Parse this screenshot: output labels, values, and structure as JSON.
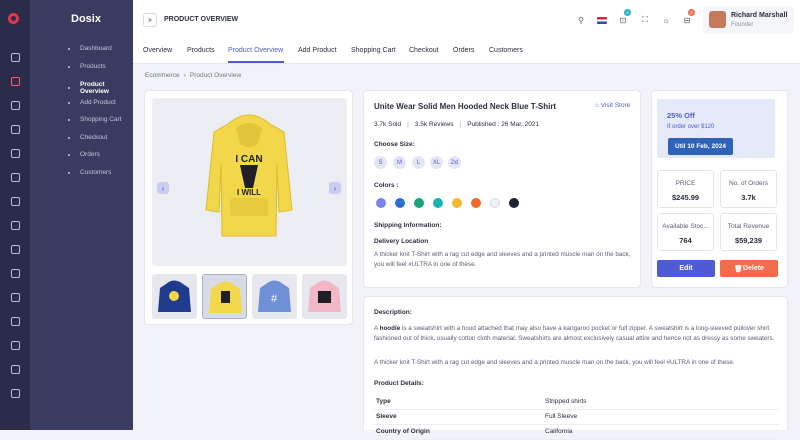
{
  "brand": {
    "name": "Dosix",
    "accent": "#e4354a",
    "sidebar_color": "#3a3b60"
  },
  "rail_icons": [
    "layout-icon",
    "cart-icon",
    "calendar-icon",
    "cards-icon",
    "mail-icon",
    "user-circle-icon",
    "id-card-icon",
    "box-icon",
    "layers-icon",
    "pen-icon",
    "table-icon",
    "grid-icon",
    "clock-icon",
    "flask-icon",
    "map-icon"
  ],
  "menu": {
    "items": [
      {
        "label": "Dashboard"
      },
      {
        "label": "Products"
      },
      {
        "label": "Product Overview"
      },
      {
        "label": "Add Product"
      },
      {
        "label": "Shopping Cart"
      },
      {
        "label": "Checkout"
      },
      {
        "label": "Orders"
      },
      {
        "label": "Customers"
      }
    ],
    "active": "Product Overview"
  },
  "header": {
    "expand_symbol": "»",
    "title": "PRODUCT OVERVIEW",
    "cart_badge": "4",
    "notif_badge": "3"
  },
  "user": {
    "name": "Richard Marshall",
    "role": "Founder"
  },
  "tabs": [
    "Overview",
    "Products",
    "Product Overview",
    "Add Product",
    "Shopping Cart",
    "Checkout",
    "Orders",
    "Customers"
  ],
  "active_tab": "Product Overview",
  "breadcrumb": {
    "parent": "Ecommerce",
    "sep": "›",
    "current": "Product Overview"
  },
  "product": {
    "name": "Unite Wear Solid Men Hooded Neck Blue T-Shirt",
    "visit_store": "Visit Store",
    "sold": "3.7k",
    "sold_label": "Sold",
    "reviews": "3.5k",
    "reviews_label": "Reviews",
    "published_label": "Published :",
    "published": "26 Mar, 2021",
    "size_title": "Choose Size:",
    "sizes": [
      "S",
      "M",
      "L",
      "XL",
      "2xl"
    ],
    "colors_title": "Colors :",
    "colors": [
      "#7c83e9",
      "#2e6dd0",
      "#1aa37a",
      "#19b3b3",
      "#f5b82e",
      "#ef6a2b",
      "#f1f2f5",
      "#1f2330"
    ],
    "shipping_title": "Shipping Information:",
    "delivery_title": "Delivery Location",
    "delivery_text": "A thicker knit T-Shirt with a rag cut edge and sleeves and a printed muscle man on the back, you will feel #ULTRA in one of these."
  },
  "offer": {
    "title": "25% Off",
    "subtitle": "If order over $120",
    "button": "Util 10 Feb, 2024"
  },
  "stats": [
    {
      "label": "PRICE",
      "value": "$245.99"
    },
    {
      "label": "No. of Orders",
      "value": "3.7k"
    },
    {
      "label": "Available Stoc...",
      "value": "764"
    },
    {
      "label": "Total Revenue",
      "value": "$59,239"
    }
  ],
  "actions": {
    "edit": "Edit",
    "delete": "Delete"
  },
  "description": {
    "title": "Description:",
    "p1_prefix": "A",
    "p1_bold": "hoodie",
    "p1_rest": "is a sweatshirt with a hood attached that may also have a kangaroo pocket or full zipper. A sweatshirt is a long-sleeved pullover shirt fashioned out of thick, usually cotton cloth material. Sweatshirts are almost exclusively casual attire and hence not as dressy as some sweaters.",
    "p2": "A thicker knit T-Shirt with a rag cut edge and sleeves and a printed muscle man on the back, you will feel #ULTRA in one of these.",
    "details_title": "Product Details:",
    "details": [
      {
        "key": "Type",
        "value": "Stripped shirts"
      },
      {
        "key": "Sleeve",
        "value": "Full Sleeve"
      },
      {
        "key": "Country of Origin",
        "value": "California"
      }
    ]
  }
}
